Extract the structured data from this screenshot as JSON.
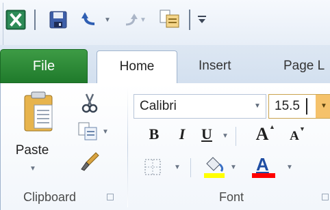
{
  "quick_access": {
    "app_icon": "excel-logo-icon",
    "buttons": [
      {
        "name": "save-icon"
      },
      {
        "name": "undo-icon"
      },
      {
        "name": "redo-icon"
      },
      {
        "name": "paste-small-icon"
      },
      {
        "name": "customize-qat-icon"
      }
    ]
  },
  "tabs": {
    "file": "File",
    "home": "Home",
    "insert": "Insert",
    "page_layout": "Page L"
  },
  "clipboard": {
    "paste_label": "Paste",
    "group_label": "Clipboard",
    "icons": [
      "clipboard-icon",
      "cut-icon",
      "copy-icon",
      "format-painter-icon"
    ]
  },
  "font": {
    "font_name": "Calibri",
    "font_size": "15.5",
    "bold": "B",
    "italic": "I",
    "underline": "U",
    "grow": "A",
    "shrink": "A",
    "font_color_glyph": "A",
    "group_label": "Font"
  },
  "colors": {
    "fill_highlight": "#ffff00",
    "font_color": "#ff0000",
    "file_tab": "#2a8a35",
    "excel_green": "#1e7145",
    "size_dropdown": "#f5c26b"
  }
}
